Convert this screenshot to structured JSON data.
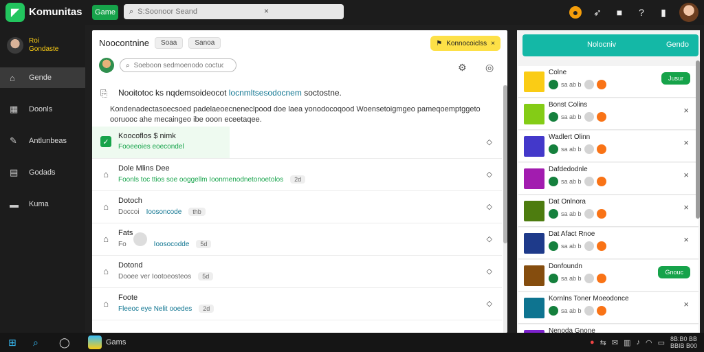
{
  "header": {
    "app_title": "Komunitas",
    "games_label": "Game",
    "search_placeholder": "S:Soonoor Seand",
    "search_clear": "×"
  },
  "sidebar": {
    "user_line1": "Roi",
    "user_line2": "Gondaste",
    "items": [
      {
        "label": "Gende",
        "icon": "home-icon"
      },
      {
        "label": "Doonls",
        "icon": "grid-icon"
      },
      {
        "label": "Antlunbeas",
        "icon": "tools-icon"
      },
      {
        "label": "Godads",
        "icon": "users-icon"
      },
      {
        "label": "Kuma",
        "icon": "folder-icon"
      }
    ]
  },
  "main": {
    "title": "Noocontnine",
    "chip1": "Soaa",
    "chip2": "Sanoa",
    "notif_label": "Konnocoiclss",
    "notif_close": "×",
    "sub_search_placeholder": "Soeboon sedmoenodo coctuc",
    "intro_line_plain": "Nooitotoc ks nqdemsoideocot",
    "intro_line_highlight": "locnmltsesodocnem",
    "intro_line_end": "soctostne.",
    "intro_para": "Kondenadectasoecsoed padelaeoecneneclpood doe laea yonodocoqood Woensetoigmgeo pameqoemptggeto ooruooc ahe mecaingeo ibe ooon eceetaqee.",
    "rows": [
      {
        "title": "Koocoflos $ nimk",
        "sub_green": "Fooeeoies eoecondel",
        "sub_blue": "",
        "tag": "",
        "icon": "check"
      },
      {
        "title": "Dole Mlins Dee",
        "sub_green": "Foonls toc ttios soe ooggellm Ioonrnenodnetonoetolos",
        "sub_blue": "",
        "tag": "2d",
        "icon": "house"
      },
      {
        "title": "Dotoch",
        "sub_green": "",
        "sub_blue": "Ioosoncode",
        "sub_plain": "Doccoi",
        "tag": "thb",
        "icon": "house"
      },
      {
        "title": "Fats",
        "sub_green": "",
        "sub_blue": "Ioosocodde",
        "sub_plain": "Fo",
        "tag": "5d",
        "icon": "house"
      },
      {
        "title": "Dotond",
        "sub_green": "",
        "sub_blue": "",
        "sub_plain": "Dooee ver Iootoeosteos",
        "tag": "5d",
        "icon": "house"
      },
      {
        "title": "Foote",
        "sub_green": "",
        "sub_blue": "Fleeoc eye Nelit ooedes",
        "sub_plain": "",
        "tag": "2d",
        "icon": "house"
      }
    ]
  },
  "right_panel": {
    "head_title": "Nolocniv",
    "head_right": "Gendo",
    "items": [
      {
        "title": "Colne",
        "sub": "sa ab b",
        "action": "Jusur",
        "thumb": "#facc15"
      },
      {
        "title": "Bonst Colins",
        "sub": "sa ab b",
        "action": "",
        "thumb": "#84cc16"
      },
      {
        "title": "Wadlert Olinn",
        "sub": "sa ab b",
        "action": "",
        "thumb": "#4338ca"
      },
      {
        "title": "Dafdedodnle",
        "sub": "sa ab b",
        "action": "",
        "thumb": "#a21caf"
      },
      {
        "title": "Dat Onlnora",
        "sub": "sa ab b",
        "action": "",
        "thumb": "#4d7c0f"
      },
      {
        "title": "Dat Afact Rnoe",
        "sub": "sa ab b",
        "action": "",
        "thumb": "#1e3a8a"
      },
      {
        "title": "Donfoundn",
        "sub": "sa ab b",
        "action": "Gnouc",
        "thumb": "#854d0e"
      },
      {
        "title": "Kornlns Toner Moeodonce",
        "sub": "sa ab b",
        "action": "",
        "thumb": "#0e7490"
      },
      {
        "title": "Nenoda Gnone",
        "sub": "",
        "action": "",
        "thumb": "#7e22ce"
      }
    ]
  },
  "taskbar": {
    "app_label": "Gams",
    "clock_time": "8B:B0 BB",
    "clock_date": "BBIB B00"
  }
}
